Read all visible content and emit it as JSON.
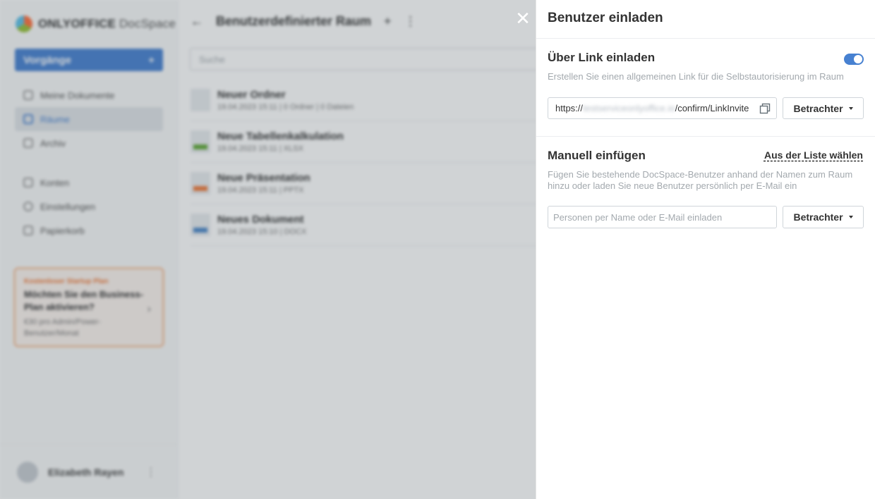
{
  "app": {
    "logo_text": "ONLYOFFICE",
    "logo_suffix": "DocSpace",
    "actions_label": "Vorgänge",
    "nav": [
      {
        "label": "Meine Dokumente",
        "icon": "user-doc-icon"
      },
      {
        "label": "Räume",
        "icon": "rooms-icon"
      },
      {
        "label": "Archiv",
        "icon": "archive-icon"
      },
      {
        "label": "Konten",
        "icon": "accounts-icon"
      },
      {
        "label": "Einstellungen",
        "icon": "gear-icon"
      },
      {
        "label": "Papierkorb",
        "icon": "trash-icon"
      }
    ],
    "promo": {
      "tag": "Kostenloser Startup Plan",
      "headline": "Möchten Sie den Business-Plan aktivieren?",
      "subtext": "€30 pro Admin/Power-Benutzer/Monat"
    },
    "user_name": "Elizabeth Rayen",
    "room_title": "Benutzerdefinierter Raum",
    "search_placeholder": "Suche",
    "files": [
      {
        "name": "Neuer Ordner",
        "meta": "19.04.2023 15:11 | 0 Ordner | 0 Dateien",
        "type": "folder"
      },
      {
        "name": "Neue Tabellenkalkulation",
        "meta": "19.04.2023 15:11 | XLSX",
        "type": "xlsx"
      },
      {
        "name": "Neue Präsentation",
        "meta": "19.04.2023 15:11 | PPTX",
        "type": "pptx"
      },
      {
        "name": "Neues Dokument",
        "meta": "19.04.2023 15:10 | DOCX",
        "type": "docx"
      }
    ]
  },
  "panel": {
    "title": "Benutzer einladen",
    "close_glyph": "✕",
    "link_section": {
      "title": "Über Link einladen",
      "description": "Erstellen Sie einen allgemeinen Link für die Selbstautorisierung im Raum",
      "toggle_on": true,
      "link_prefix": "https://",
      "link_hidden": "testserviceonlyoffice.io",
      "link_suffix": "/confirm/LinkInvite",
      "role_label": "Betrachter"
    },
    "manual_section": {
      "title": "Manuell einfügen",
      "pick_from_list": "Aus der Liste wählen",
      "description": "Fügen Sie bestehende DocSpace-Benutzer anhand der Namen zum Raum hinzu oder laden Sie neue Benutzer persönlich per E-Mail ein",
      "input_placeholder": "Personen per Name oder E-Mail einladen",
      "role_label": "Betrachter"
    }
  },
  "colors": {
    "accent": "#4781d1",
    "muted_text": "#a3a9ae",
    "border": "#d0d5da",
    "promo_orange": "#ef7a3a"
  }
}
